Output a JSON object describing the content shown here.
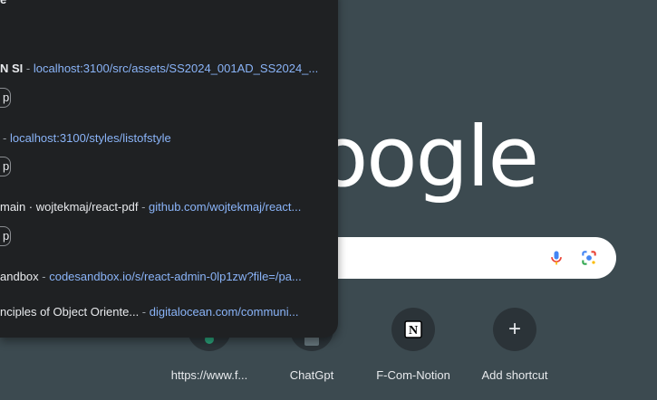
{
  "google": {
    "logo_text": "oogle"
  },
  "shortcuts": [
    {
      "label": "https://www.f...",
      "icon": "site-favicon-icon"
    },
    {
      "label": "ChatGpt",
      "icon": "chatgpt-icon"
    },
    {
      "label": "F-Com-Notion",
      "icon": "notion-icon"
    },
    {
      "label": "Add shortcut",
      "icon": "plus-icon"
    }
  ],
  "dropdown": {
    "top_fragment": "e",
    "rows": [
      {
        "title": "N SI",
        "sep": " - ",
        "url": "localhost:3100/src/assets/SS2024_001AD_SS2024_..."
      },
      {
        "title": "",
        "sep": "- ",
        "url": "localhost:3100/styles/listofstyle"
      },
      {
        "title": "main · wojtekmaj/react-pdf",
        "sep": " - ",
        "url": "github.com/wojtekmaj/react..."
      },
      {
        "title": "andbox",
        "sep": " - ",
        "url": "codesandbox.io/s/react-admin-0lp1zw?file=/pa..."
      },
      {
        "title": "nciples of Object Oriente...",
        "sep": "  - ",
        "url": "digitalocean.com/communi..."
      }
    ],
    "chip_label": "p"
  },
  "colors": {
    "page_bg": "#3c4a50",
    "panel_bg": "#1f2123",
    "link": "#8ab4f8"
  }
}
